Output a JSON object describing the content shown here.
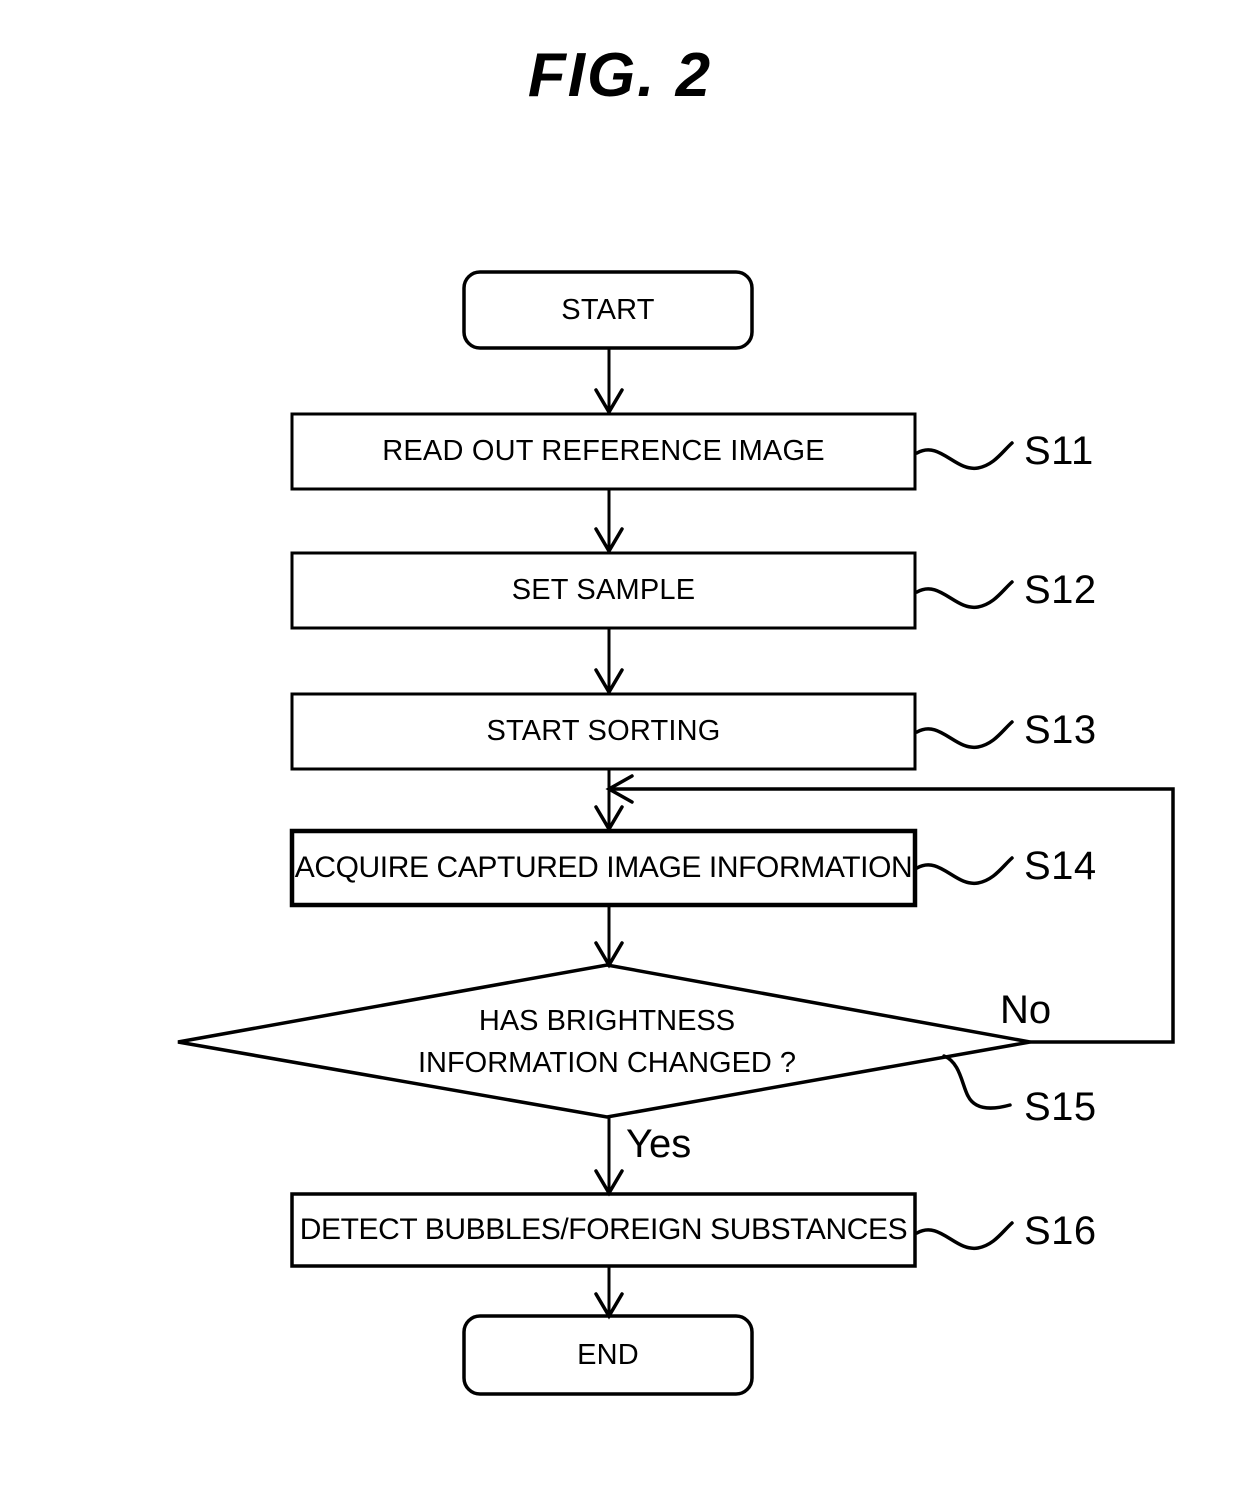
{
  "figure": {
    "title": "FIG. 2",
    "type": "flowchart"
  },
  "nodes": {
    "start": {
      "label": "START",
      "shape": "rounded-terminator"
    },
    "s11": {
      "label": "READ OUT REFERENCE IMAGE",
      "shape": "process",
      "tag": "S11"
    },
    "s12": {
      "label": "SET SAMPLE",
      "shape": "process",
      "tag": "S12"
    },
    "s13": {
      "label": "START SORTING",
      "shape": "process",
      "tag": "S13"
    },
    "s14": {
      "label": "ACQUIRE CAPTURED IMAGE INFORMATION",
      "shape": "process",
      "tag": "S14"
    },
    "s15": {
      "label_line1": "HAS BRIGHTNESS",
      "label_line2": "INFORMATION CHANGED ?",
      "shape": "decision",
      "tag": "S15"
    },
    "s16": {
      "label": "DETECT BUBBLES/FOREIGN SUBSTANCES",
      "shape": "process",
      "tag": "S16"
    },
    "end": {
      "label": "END",
      "shape": "rounded-terminator"
    }
  },
  "branches": {
    "yes": "Yes",
    "no": "No"
  },
  "colors": {
    "stroke": "#000000",
    "fill": "#ffffff",
    "text": "#000000"
  }
}
